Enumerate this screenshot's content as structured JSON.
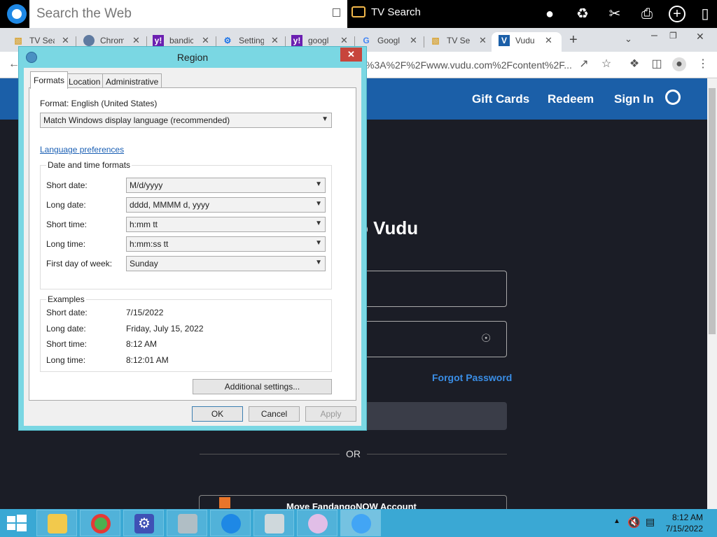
{
  "toolbar": {
    "search_placeholder": "Search the Web",
    "tv_search_label": "TV Search"
  },
  "tabs": [
    {
      "title": "TV Sea",
      "favicon": "tv-icon",
      "active": false
    },
    {
      "title": "Chrom",
      "favicon": "chrome-icon",
      "active": false
    },
    {
      "title": "bandic",
      "favicon": "yahoo-icon",
      "active": false
    },
    {
      "title": "Setting",
      "favicon": "gear-icon",
      "active": false
    },
    {
      "title": "googl",
      "favicon": "yahoo-icon",
      "active": false
    },
    {
      "title": "Googl",
      "favicon": "google-icon",
      "active": false
    },
    {
      "title": "TV Se",
      "favicon": "tv-icon",
      "active": false
    },
    {
      "title": "Vudu",
      "favicon": "vudu-icon",
      "active": true
    }
  ],
  "address": {
    "url_fragment": "%3A%2F%2Fwww.vudu.com%2Fcontent%2F..."
  },
  "vudu": {
    "nav": [
      "Gift Cards",
      "Redeem",
      "Sign In"
    ],
    "heading": "o Vudu",
    "forgot_password": "Forgot Password",
    "or_label": "OR",
    "move_account": "Move FandangoNOW Account"
  },
  "dialog": {
    "title": "Region",
    "tabs": [
      "Formats",
      "Location",
      "Administrative"
    ],
    "format_label": "Format: English (United States)",
    "format_value": "Match Windows display language (recommended)",
    "language_link": "Language preferences",
    "date_time_group": "Date and time formats",
    "fields": [
      {
        "label": "Short date:",
        "value": "M/d/yyyy"
      },
      {
        "label": "Long date:",
        "value": "dddd, MMMM d, yyyy"
      },
      {
        "label": "Short time:",
        "value": "h:mm tt"
      },
      {
        "label": "Long time:",
        "value": "h:mm:ss tt"
      },
      {
        "label": "First day of week:",
        "value": "Sunday"
      }
    ],
    "examples_group": "Examples",
    "examples": [
      {
        "label": "Short date:",
        "value": "7/15/2022"
      },
      {
        "label": "Long date:",
        "value": "Friday, July 15, 2022"
      },
      {
        "label": "Short time:",
        "value": "8:12 AM"
      },
      {
        "label": "Long time:",
        "value": "8:12:01 AM"
      }
    ],
    "additional_settings": "Additional settings...",
    "ok": "OK",
    "cancel": "Cancel",
    "apply": "Apply"
  },
  "taskbar": {
    "time": "8:12 AM",
    "date": "7/15/2022"
  },
  "colors": {
    "vudu_nav": "#1b5fa8",
    "dialog_frame": "#7ad7e3",
    "taskbar": "#3aa8d4",
    "close_red": "#c7453c"
  }
}
